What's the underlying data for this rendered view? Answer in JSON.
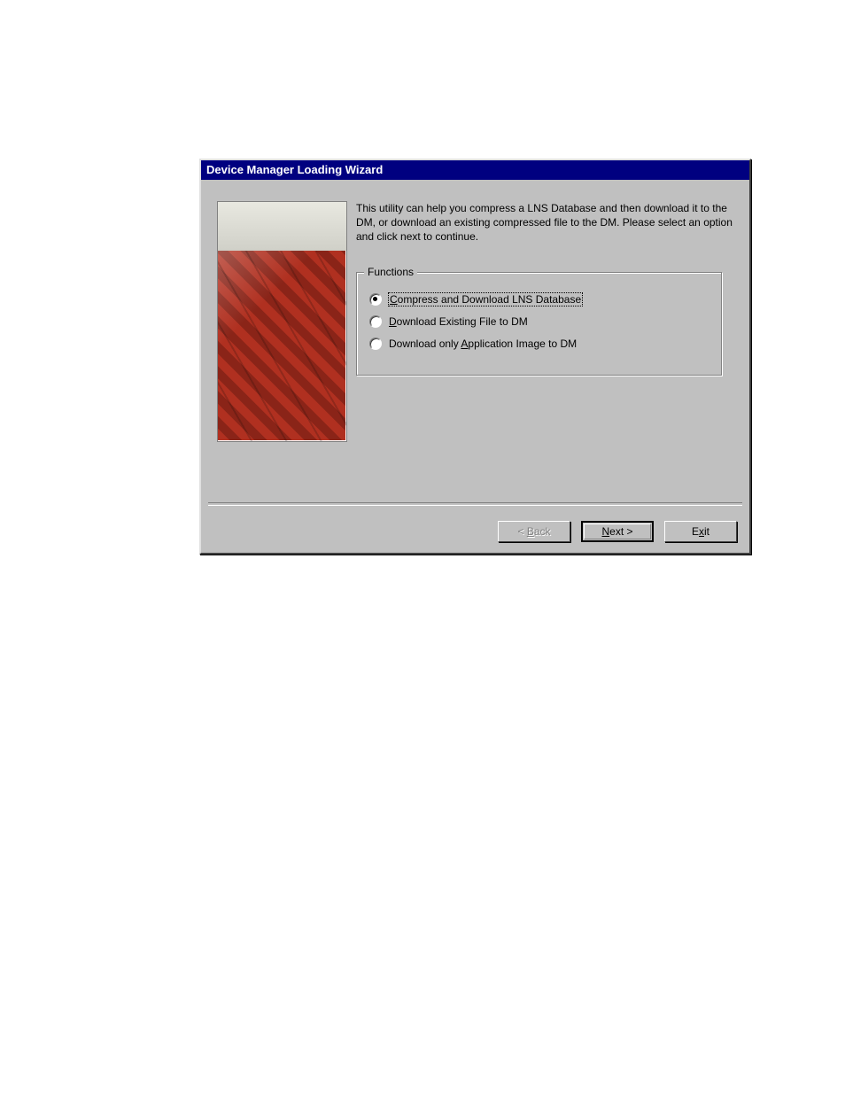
{
  "window": {
    "title": "Device Manager Loading Wizard"
  },
  "description": "This utility can help you compress a LNS Database and then download it to the DM, or download an existing compressed file to the DM. Please select an option and click next to continue.",
  "functions": {
    "legend": "Functions",
    "options": [
      {
        "label": "Compress and Download LNS Database",
        "accel_index": 0,
        "selected": true
      },
      {
        "label": "Download Existing File to DM",
        "accel_index": 0,
        "selected": false
      },
      {
        "label": "Download only Application Image to DM",
        "accel_index": 14,
        "selected": false
      }
    ]
  },
  "buttons": {
    "back": {
      "label": "< Back",
      "accel_index": 2,
      "enabled": false
    },
    "next": {
      "label": "Next >",
      "accel_index": 0,
      "enabled": true,
      "default": true
    },
    "exit": {
      "label": "Exit",
      "accel_index": 1,
      "enabled": true
    }
  }
}
